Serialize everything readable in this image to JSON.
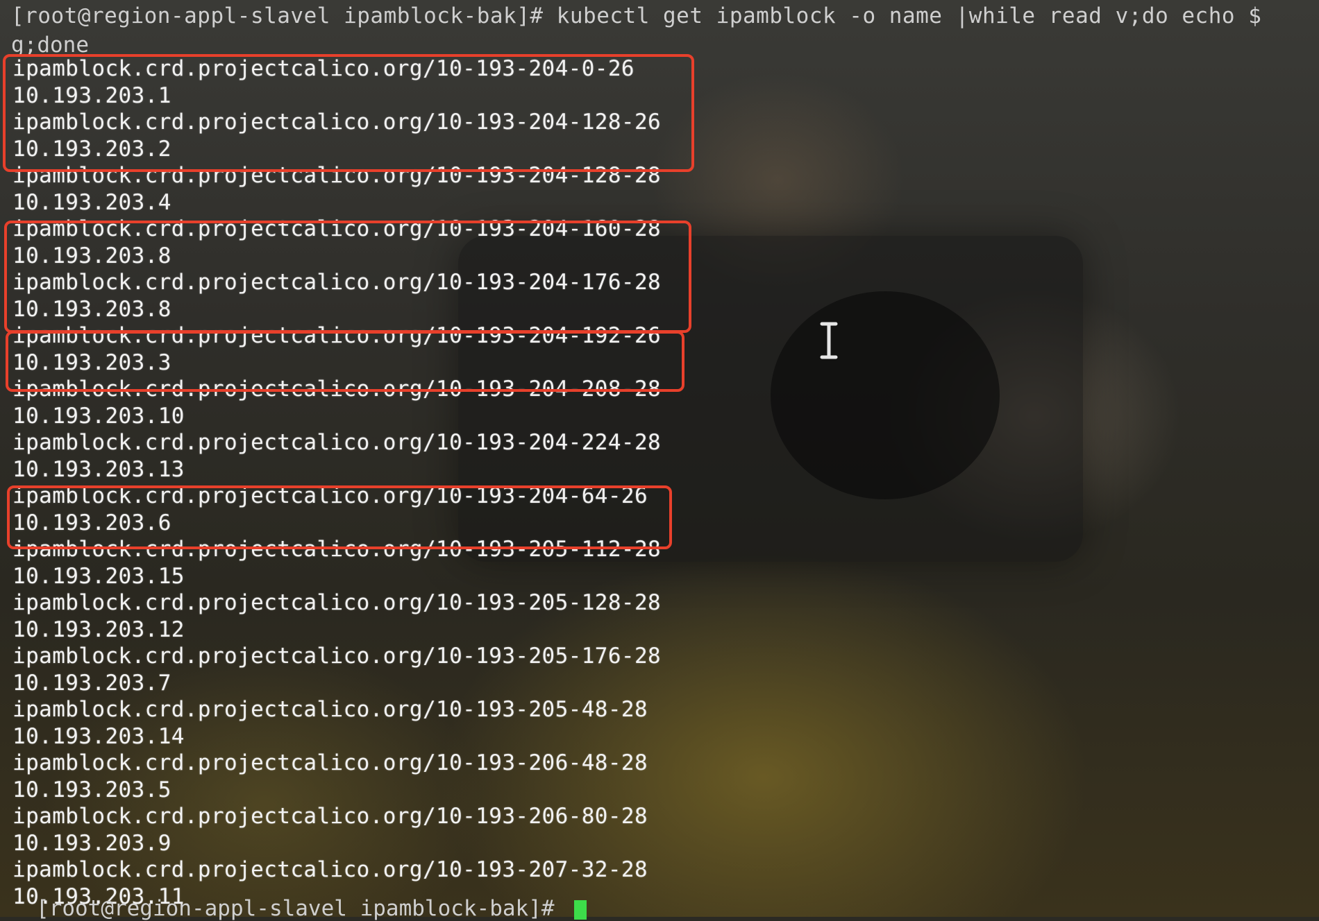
{
  "terminal": {
    "command_line": "[root@region-appl-slavel ipamblock-bak]# kubectl  get ipamblock -o name  |while read v;do echo $",
    "command_wrap": "g;done",
    "output_lines": [
      "ipamblock.crd.projectcalico.org/10-193-204-0-26",
      "10.193.203.1",
      "ipamblock.crd.projectcalico.org/10-193-204-128-26",
      "10.193.203.2",
      "ipamblock.crd.projectcalico.org/10-193-204-128-28",
      "10.193.203.4",
      "ipamblock.crd.projectcalico.org/10-193-204-160-28",
      "10.193.203.8",
      "ipamblock.crd.projectcalico.org/10-193-204-176-28",
      "10.193.203.8",
      "ipamblock.crd.projectcalico.org/10-193-204-192-26",
      "10.193.203.3",
      "ipamblock.crd.projectcalico.org/10-193-204-208-28",
      "10.193.203.10",
      "ipamblock.crd.projectcalico.org/10-193-204-224-28",
      "10.193.203.13",
      "ipamblock.crd.projectcalico.org/10-193-204-64-26",
      "10.193.203.6",
      "ipamblock.crd.projectcalico.org/10-193-205-112-28",
      "10.193.203.15",
      "ipamblock.crd.projectcalico.org/10-193-205-128-28",
      "10.193.203.12",
      "ipamblock.crd.projectcalico.org/10-193-205-176-28",
      "10.193.203.7",
      "ipamblock.crd.projectcalico.org/10-193-205-48-28",
      "10.193.203.14",
      "ipamblock.crd.projectcalico.org/10-193-206-48-28",
      "10.193.203.5",
      "ipamblock.crd.projectcalico.org/10-193-206-80-28",
      "10.193.203.9",
      "ipamblock.crd.projectcalico.org/10-193-207-32-28",
      "10.193.203.11"
    ],
    "prompt": "[root@region-appl-slavel ipamblock-bak]# "
  },
  "colors": {
    "highlight": "#e8402b",
    "cursor": "#3ddc4a",
    "text": "#f2f2f2"
  },
  "icons": [
    "text-cursor-icon"
  ]
}
